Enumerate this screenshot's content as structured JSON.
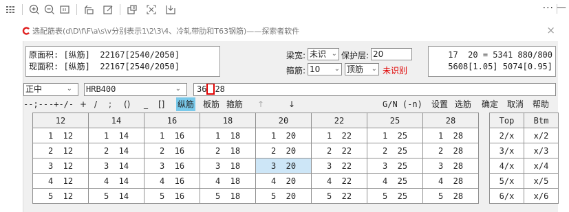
{
  "toolbar": {
    "icons": [
      "grid-icon",
      "zoom-in-icon",
      "zoom-out-icon",
      "fit-icon",
      "rotate-icon",
      "edit-icon",
      "export-icon",
      "fullscreen-icon",
      "save-icon"
    ],
    "more": "···",
    "minimize": "—"
  },
  "window": {
    "title": "选配筋表(d\\D\\f\\F\\a\\s\\v分别表示1\\2\\3\\4、冷轧带肋和T63钢筋)——探索者软件",
    "close": "×"
  },
  "area": {
    "line1": "原面积: [纵筋]  22167[2540/2050]",
    "line2": "现面积: [纵筋]  22167[2540/2050]"
  },
  "controls": {
    "beam_width_label": "梁宽:",
    "beam_width_value": "未识",
    "cover_label": "保护层:",
    "cover_value": "20",
    "stirrup_label": "箍筋:",
    "stirrup_value": "10",
    "top_rebar_value": "顶筋",
    "unrecognized": "未识别"
  },
  "calc": {
    "line1": "17  20 = 5341 880/800",
    "line2": "5608[1.05] 5074[0.95]"
  },
  "input_row": {
    "position_value": "正中",
    "grade_value": "HRB400",
    "input_prefix": "36",
    "input_suffix": "28"
  },
  "symbols": {
    "s1": "--;--",
    "s2": "-+-/-",
    "s3": "+",
    "s4": "/",
    "s5": ";",
    "s6": "()",
    "s7": "_",
    "s8": "[]",
    "zongjin": "纵筋",
    "banjin": "板筋",
    "gujin": "箍筋",
    "up": "↑",
    "down": "↓",
    "gn": "G/N (-n)",
    "shezhi": "设置",
    "xuanjin": "选筋",
    "queding": "确定",
    "quxiao": "取消",
    "bangzhu": "帮助"
  },
  "table": {
    "headers": [
      "12",
      "14",
      "16",
      "18",
      "20",
      "22",
      "25",
      "28"
    ],
    "rows": [
      [
        "1  12",
        "1  14",
        "1  16",
        "1  18",
        "1  20",
        "1  22",
        "1  25",
        "1  28"
      ],
      [
        "2  12",
        "2  14",
        "2  16",
        "2  18",
        "2  20",
        "2  22",
        "2  25",
        "2  28"
      ],
      [
        "3  12",
        "3  14",
        "3  16",
        "3  18",
        "3  20",
        "3  22",
        "3  25",
        "3  28"
      ],
      [
        "4  12",
        "4  14",
        "4  16",
        "4  18",
        "4  20",
        "4  22",
        "4  25",
        "4  28"
      ],
      [
        "5  12",
        "5  14",
        "5  16",
        "5  18",
        "5  20",
        "5  22",
        "5  25",
        "5  28"
      ]
    ]
  },
  "side_table": {
    "headers": [
      "Top",
      "Btm"
    ],
    "rows": [
      [
        "2/x",
        "x/2"
      ],
      [
        "3/x",
        "x/3"
      ],
      [
        "4/x",
        "x/4"
      ],
      [
        "5/x",
        "x/5"
      ],
      [
        "6/x",
        "x/6"
      ]
    ]
  }
}
